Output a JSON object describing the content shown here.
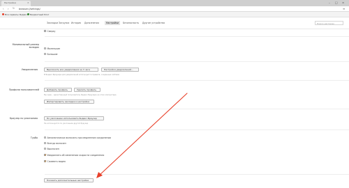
{
  "window": {
    "tab_title": "Настройки",
    "tab_close": "×",
    "minimize": "–",
    "maximize": "□",
    "close": "×"
  },
  "address_bar": {
    "back": "‹",
    "forward": "›",
    "reload": "↻",
    "url": "browser://settings/",
    "menu_icon": "≡"
  },
  "bookmarks": [
    {
      "label": "Все сервисы Яндекса",
      "icon_color": "#e8402a"
    },
    {
      "label": "Бюджетный блог",
      "icon_color": "#3a8f3a"
    }
  ],
  "settings_nav": {
    "items": [
      "Закладки",
      "Загрузки",
      "История",
      "Дополнения",
      "Настройки",
      "Безопасность",
      "Другие устройства"
    ],
    "active_index": 4,
    "search_placeholder": "Поиск настроек"
  },
  "top_option": {
    "label": "Сверху",
    "checked": false
  },
  "tabs_size": {
    "label": "Минимальный размер вкладок",
    "options": [
      {
        "label": "Маленькие",
        "selected": true
      },
      {
        "label": "Большие",
        "selected": false
      }
    ]
  },
  "notifications": {
    "label": "Уведомления",
    "buttons": [
      "Выключить все уведомления на 3 часа",
      "Настройка уведомлений..."
    ],
    "hint": "В Яндекс.Браузере для уведомлений используются правила, созданные сайтами"
  },
  "profiles": {
    "label": "Профили пользователей",
    "buttons": [
      "Добавить профиль",
      "Удалить профиль"
    ],
    "hint": "Вы один – единственный пользователь Яндекс.Браузера на этом компьютере",
    "import_button": "Импортировать закладки и настройки"
  },
  "default_browser": {
    "label": "Браузер по умолчанию",
    "button": "По умолчанию использовать Яндекс.Браузер",
    "hint": "Не используется по умолчанию другой браузер"
  },
  "turbo": {
    "label": "Турбо",
    "options": [
      {
        "label": "Автоматически включать при медленном соединении",
        "selected": true
      },
      {
        "label": "Всегда включен",
        "selected": false
      },
      {
        "label": "Выключен",
        "selected": false
      }
    ],
    "checkboxes": [
      {
        "label": "Уведомлять об изменении скорости соединения",
        "checked": true
      },
      {
        "label": "Сжимать видео",
        "checked": true
      }
    ]
  },
  "show_more_button": "Показать дополнительные настройки",
  "annotation": {
    "arrow_color": "#e8402a"
  }
}
